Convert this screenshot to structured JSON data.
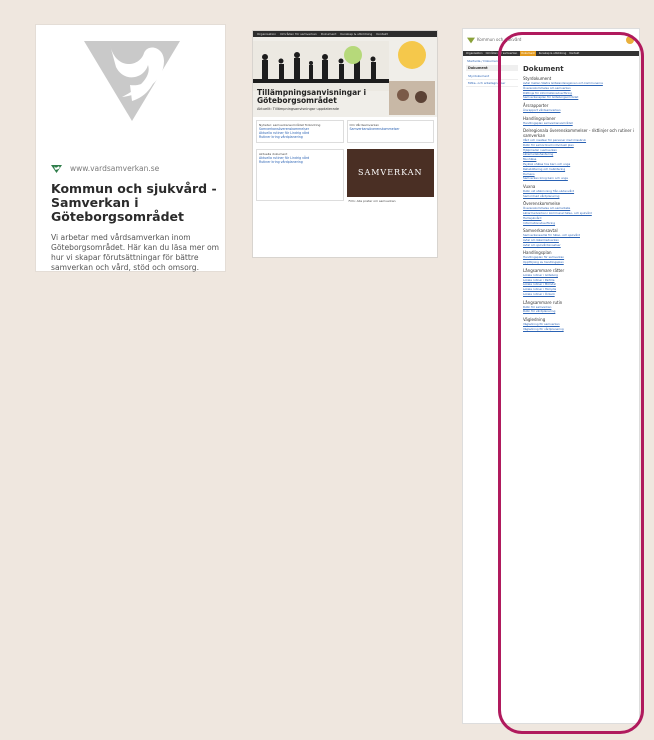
{
  "card": {
    "url": "www.vardsamverkan.se",
    "title": "Kommun och sjukvård - Samverkan i Göteborgsområdet",
    "description": "Vi arbetar med vårdsamverkan inom Göteborgsområdet. Här kan du läsa mer om hur vi skapar förutsättningar för bättre samverkan och vård, stöd och omsorg."
  },
  "thumbnail": {
    "nav": [
      "Organisation",
      "Områden för samverkan",
      "Dokument",
      "Kunskap & utbildning",
      "Kontakt"
    ],
    "hero_title_line1": "Tillämpningsanvisningar i",
    "hero_title_line2": "Göteborgsområdet",
    "hero_sub": "Aktuellt: Tillämpningsanvisningar uppdaterade",
    "news_head": "Nyheter: samverkansområdet förändring",
    "news_links": [
      "Samverkansöverenskommelser",
      "Aktuella rutiner för Lindrig vård",
      "Rutiner kring vårdplanering"
    ],
    "box_head": "Aktuella dokument",
    "box2_head": "Om Vårdsamverkan",
    "video_label": "SAMVERKAN",
    "video_caption": "Film: Alla pratar om samverkan"
  },
  "page": {
    "brand": "Kommun och sjukvård",
    "nav": [
      "Organisation",
      "Områden för samverkan",
      "Dokument",
      "Kunskap & utbildning",
      "Kontakt"
    ],
    "active_nav": "Dokument",
    "breadcrumb": "Startsida / Dokument",
    "sidebar_head": "Dokument",
    "sidebar_items": [
      "Styrdokument",
      "Möte- och arbetsgrupper"
    ],
    "title": "Dokument",
    "sections": [
      {
        "head": "Styrdokument",
        "links": [
          "Avtal mellan Västra Götalandsregionen och kommunerna",
          "Överenskommelse om samverkan",
          "Riktlinje för informationsöverföring",
          "Samverkansplan för Göteborgsområdet"
        ]
      },
      {
        "head": "Årsrapporter",
        "links": [
          "Årsrapport vårdsamverkan"
        ]
      },
      {
        "head": "Handlingsplaner",
        "links": [
          "Handlingsplan samverkansområdet"
        ]
      },
      {
        "head": "Delregionala överenskommelser - riktlinjer och rutiner i samverkan",
        "links": [
          "Vård och insatser för personer med missbruk",
          "Rutin för samordnad individuell plan",
          "Hjälpmedel i samverkan",
          "Läkemedelshantering",
          "Munhälsa",
          "Psykisk ohälsa hos barn och unga",
          "Rehabilitering och habilitering",
          "Demens",
          "Samverkan kring barn och unga"
        ]
      },
      {
        "head": "Vuxna",
        "links": [
          "Rutin vid utskrivning från slutenvård",
          "Samordnad vårdplanering"
        ]
      },
      {
        "head": "Överenskommelse",
        "links": [
          "Överenskommelse om samarbete",
          "Läkarmedverkan i kommunal hälso- och sjukvård",
          "Hemsjukvård",
          "Informationsöverföring"
        ]
      },
      {
        "head": "Samverkansavtal",
        "links": [
          "Samverkansavtal för hälso- och sjukvård",
          "Avtal om läkarmedverkan",
          "Avtal om sjukvårdsinsatser"
        ]
      },
      {
        "head": "Handlingsplan",
        "links": [
          "Handlingsplan för samverkan",
          "Uppföljning av handlingsplan"
        ]
      },
      {
        "head": "Långsammare rätter",
        "links": [
          "Lokala rutiner i Göteborg",
          "Lokala rutiner i Partille",
          "Lokala rutiner i Mölndal",
          "Lokala rutiner i Härryda",
          "Lokala rutiner i Öckerö"
        ]
      },
      {
        "head": "Långsammare rutin",
        "links": [
          "Rutin för samverkan",
          "Rutin för vårdplanering"
        ]
      },
      {
        "head": "Vägledning",
        "links": [
          "Vägledning för samverkan",
          "Vägledning för vårdplanering"
        ]
      }
    ]
  }
}
